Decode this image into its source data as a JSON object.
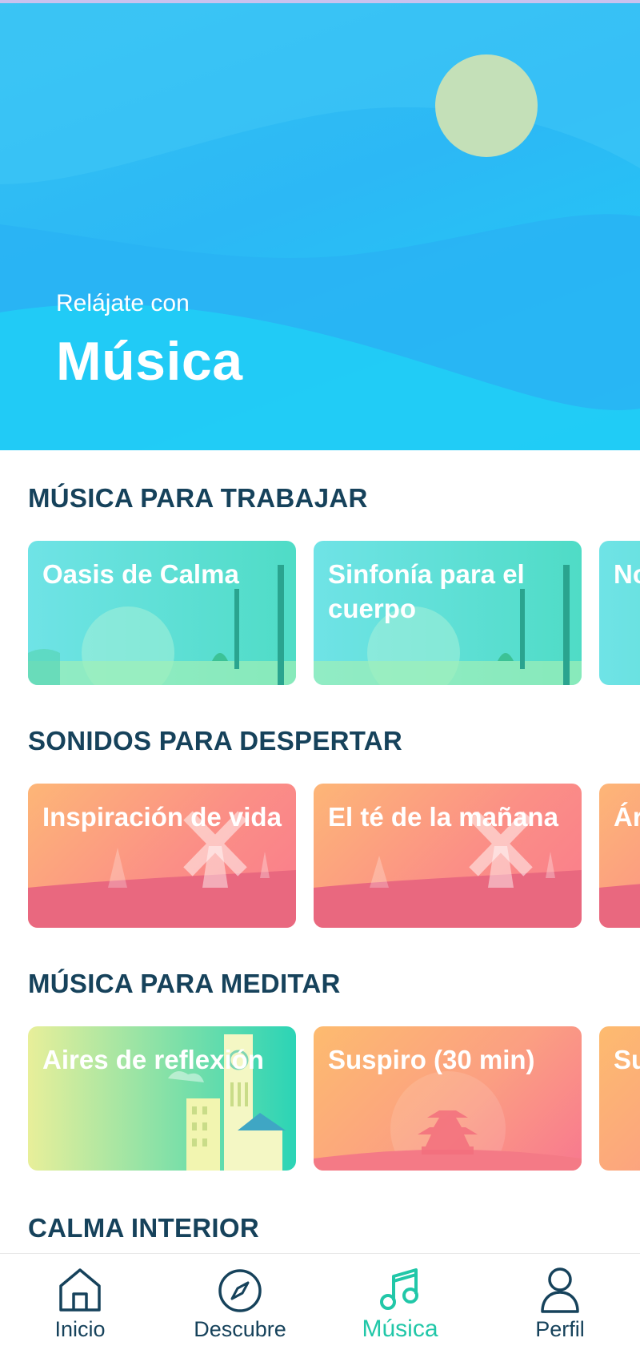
{
  "hero": {
    "subtitle": "Relájate con",
    "title": "Música"
  },
  "sections": [
    {
      "title": "MÚSICA PARA TRABAJAR",
      "cards": [
        {
          "label": "Oasis de Calma",
          "theme": "teal"
        },
        {
          "label": "Sinfonía para el cuerpo",
          "theme": "teal"
        },
        {
          "label": "No",
          "theme": "teal"
        }
      ]
    },
    {
      "title": "SONIDOS PARA DESPERTAR",
      "cards": [
        {
          "label": "Inspiración de vida",
          "theme": "sunset"
        },
        {
          "label": "El té de la mañana",
          "theme": "sunset"
        },
        {
          "label": "Ár co",
          "theme": "sunset"
        }
      ]
    },
    {
      "title": "MÚSICA PARA MEDITAR",
      "cards": [
        {
          "label": "Aires de reflexión",
          "theme": "green"
        },
        {
          "label": "Suspiro (30 min)",
          "theme": "peach"
        },
        {
          "label": "Su m",
          "theme": "peach"
        }
      ]
    },
    {
      "title": "CALMA INTERIOR",
      "cards": []
    }
  ],
  "nav": {
    "items": [
      {
        "label": "Inicio",
        "icon": "home-icon",
        "active": false
      },
      {
        "label": "Descubre",
        "icon": "compass-icon",
        "active": false
      },
      {
        "label": "Música",
        "icon": "music-note-icon",
        "active": true
      },
      {
        "label": "Perfil",
        "icon": "profile-icon",
        "active": false
      }
    ]
  },
  "colors": {
    "accent": "#21c7a8",
    "heading": "#16425b",
    "hero": "#2cb8f5"
  }
}
